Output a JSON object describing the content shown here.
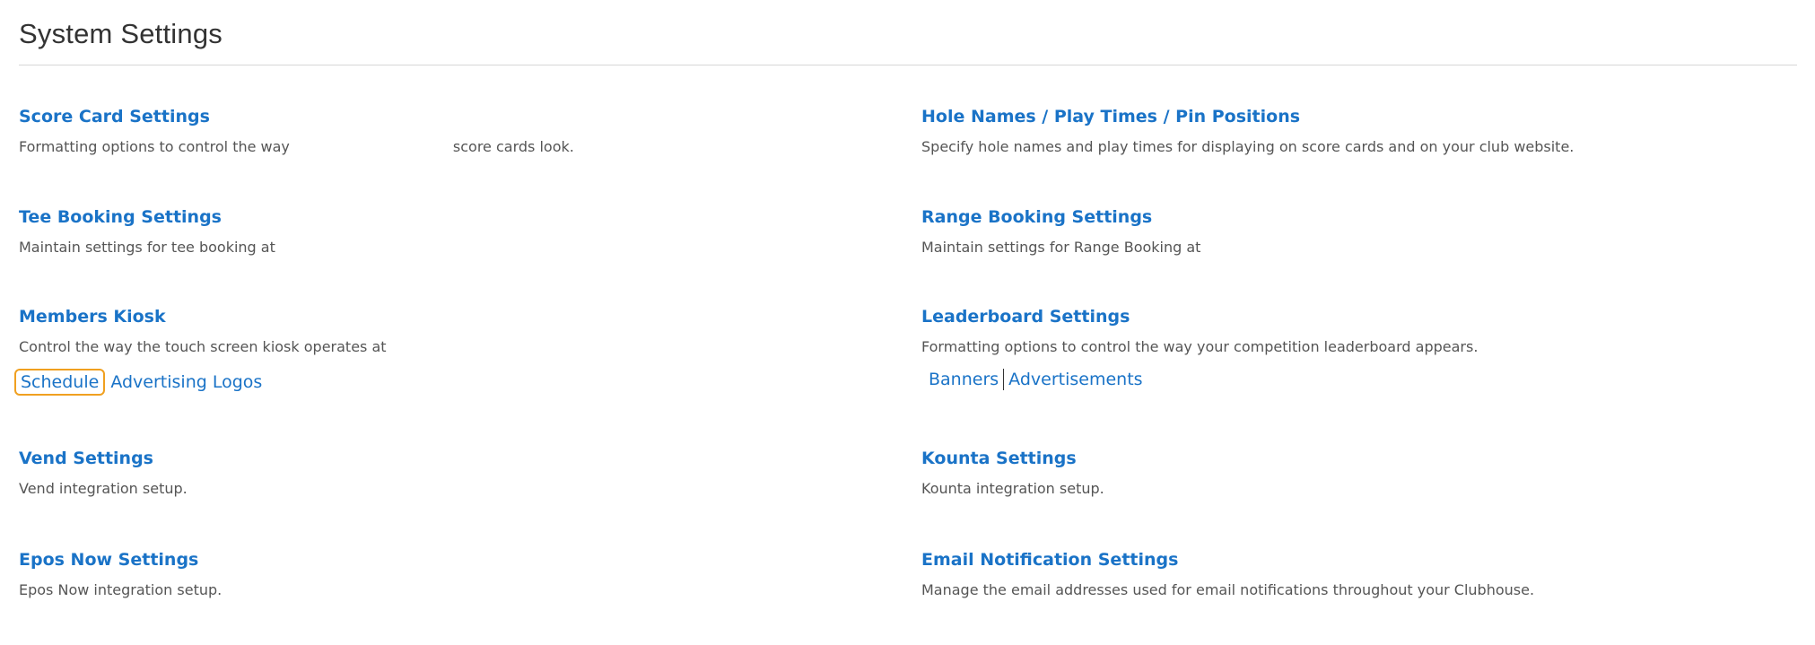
{
  "page": {
    "title": "System Settings"
  },
  "left_column": [
    {
      "title": "Score Card Settings",
      "description_part1": "Formatting options to control the way",
      "description_part2": "score cards look."
    },
    {
      "title": "Tee Booking Settings",
      "description": "Maintain settings for tee booking at"
    },
    {
      "title": "Members Kiosk",
      "description": "Control the way the touch screen kiosk operates at",
      "links": [
        "Schedule",
        "Advertising Logos"
      ]
    },
    {
      "title": "Vend Settings",
      "description": "Vend integration setup."
    },
    {
      "title": "Epos Now Settings",
      "description": "Epos Now integration setup."
    }
  ],
  "right_column": [
    {
      "title": "Hole Names / Play Times / Pin Positions",
      "description": "Specify hole names and play times for displaying on score cards and on your club website."
    },
    {
      "title": "Range Booking Settings",
      "description": "Maintain settings for Range Booking at"
    },
    {
      "title": "Leaderboard Settings",
      "description": "Formatting options to control the way your competition leaderboard appears.",
      "links": [
        "Banners",
        "Advertisements"
      ]
    },
    {
      "title": "Kounta Settings",
      "description": "Kounta integration setup."
    },
    {
      "title": "Email Notification Settings",
      "description": "Manage the email addresses used for email notifications throughout your Clubhouse."
    }
  ],
  "colors": {
    "link": "#1a73c7",
    "text": "#555555",
    "title": "#333333",
    "focus_ring": "#f0a020",
    "divider": "#d6d6d6"
  }
}
